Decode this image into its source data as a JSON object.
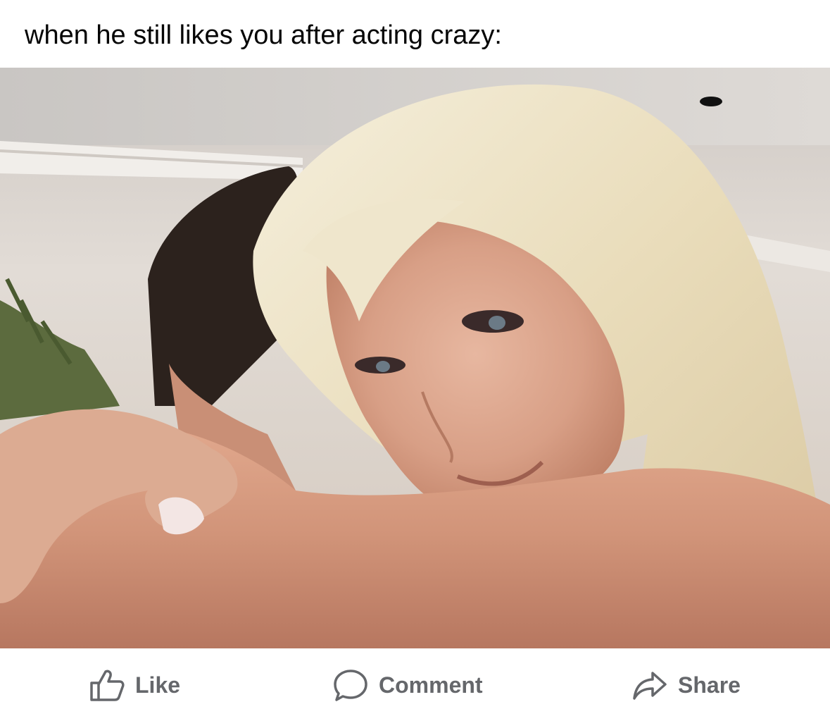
{
  "post": {
    "text": "when he still likes you after acting crazy:"
  },
  "photo": {
    "description_icon": "photo-image"
  },
  "actions": {
    "like": {
      "label": "Like",
      "icon": "thumbs-up-icon"
    },
    "comment": {
      "label": "Comment",
      "icon": "speech-bubble-icon"
    },
    "share": {
      "label": "Share",
      "icon": "share-arrow-icon"
    }
  },
  "colors": {
    "text": "#050505",
    "action_text": "#65676b"
  }
}
